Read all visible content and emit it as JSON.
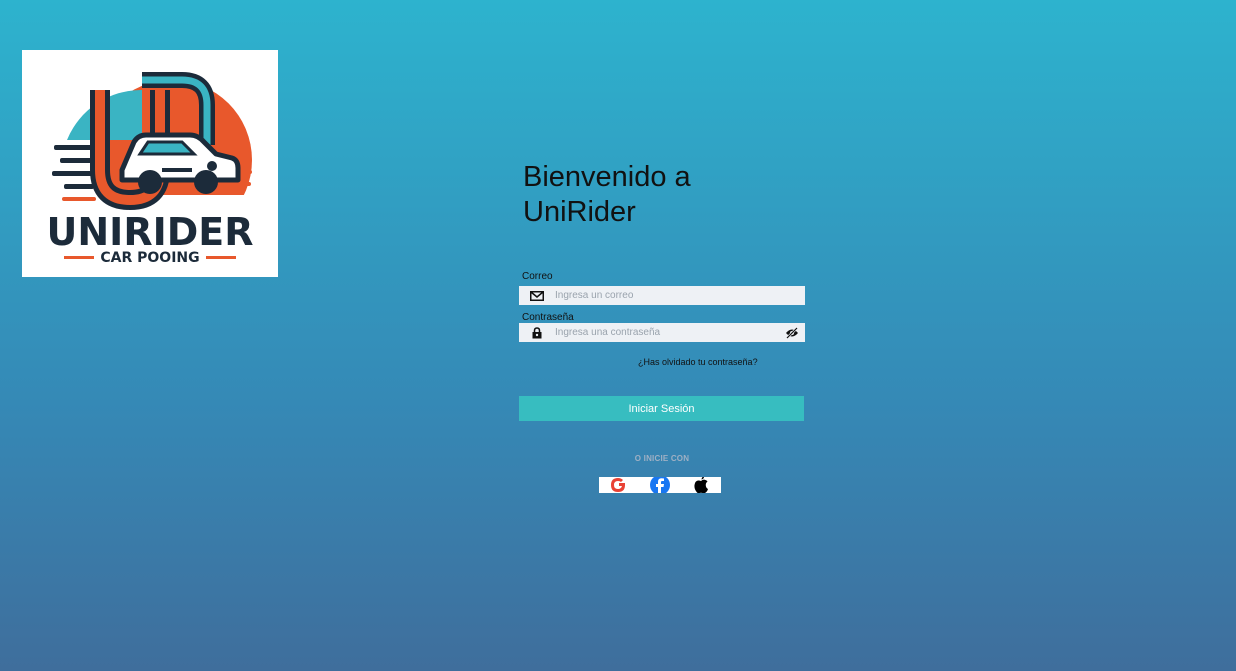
{
  "logo": {
    "brand": "UNIRIDER",
    "tagline": "CAR POOING"
  },
  "login": {
    "title": "Bienvenido a UniRider",
    "email_label": "Correo",
    "email_placeholder": "Ingresa un correo",
    "password_label": "Contraseña",
    "password_placeholder": "Ingresa una contraseña",
    "forgot_link": "¿Has olvidado tu contraseña?",
    "submit_label": "Iniciar Sesión",
    "alt_login_text": "O INICIE CON"
  },
  "icons": {
    "email": "mail-icon",
    "password": "lock-icon",
    "toggle_password": "eye-off-icon",
    "social": [
      "google-icon",
      "facebook-icon",
      "apple-icon"
    ]
  },
  "colors": {
    "background_top": "#2db3ce",
    "background_bottom": "#3f6e9c",
    "primary_button": "#37bdc0",
    "input_bg": "#eef1f5"
  }
}
